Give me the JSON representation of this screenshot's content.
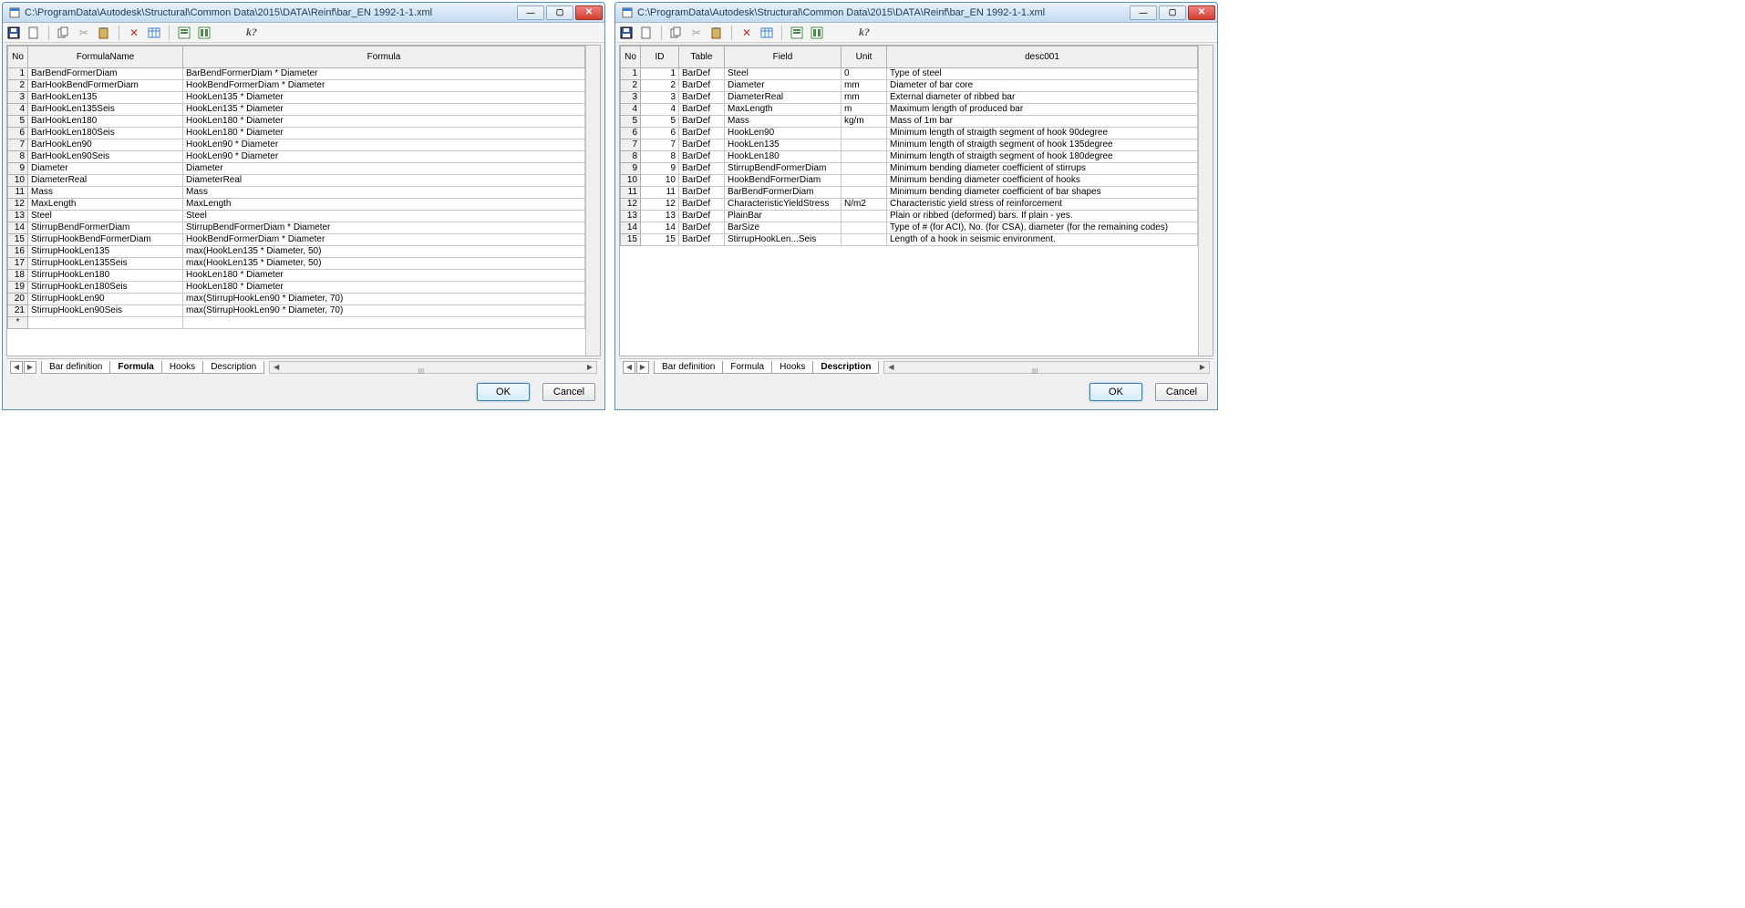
{
  "window1": {
    "title": "C:\\ProgramData\\Autodesk\\Structural\\Common Data\\2015\\DATA\\Reinf\\bar_EN 1992-1-1.xml",
    "headers": {
      "no": "No",
      "formulaName": "FormulaName",
      "formula": "Formula"
    },
    "rows": [
      {
        "no": "1",
        "name": "BarBendFormerDiam",
        "formula": "BarBendFormerDiam * Diameter"
      },
      {
        "no": "2",
        "name": "BarHookBendFormerDiam",
        "formula": "HookBendFormerDiam * Diameter"
      },
      {
        "no": "3",
        "name": "BarHookLen135",
        "formula": "HookLen135 * Diameter"
      },
      {
        "no": "4",
        "name": "BarHookLen135Seis",
        "formula": "HookLen135 * Diameter"
      },
      {
        "no": "5",
        "name": "BarHookLen180",
        "formula": "HookLen180 * Diameter"
      },
      {
        "no": "6",
        "name": "BarHookLen180Seis",
        "formula": "HookLen180 * Diameter"
      },
      {
        "no": "7",
        "name": "BarHookLen90",
        "formula": "HookLen90 * Diameter"
      },
      {
        "no": "8",
        "name": "BarHookLen90Seis",
        "formula": "HookLen90 * Diameter"
      },
      {
        "no": "9",
        "name": "Diameter",
        "formula": "Diameter"
      },
      {
        "no": "10",
        "name": "DiameterReal",
        "formula": "DiameterReal"
      },
      {
        "no": "11",
        "name": "Mass",
        "formula": "Mass"
      },
      {
        "no": "12",
        "name": "MaxLength",
        "formula": "MaxLength"
      },
      {
        "no": "13",
        "name": "Steel",
        "formula": "Steel"
      },
      {
        "no": "14",
        "name": "StirrupBendFormerDiam",
        "formula": "StirrupBendFormerDiam * Diameter"
      },
      {
        "no": "15",
        "name": "StirrupHookBendFormerDiam",
        "formula": "HookBendFormerDiam * Diameter"
      },
      {
        "no": "16",
        "name": "StirrupHookLen135",
        "formula": "max(HookLen135 * Diameter, 50)"
      },
      {
        "no": "17",
        "name": "StirrupHookLen135Seis",
        "formula": "max(HookLen135 * Diameter, 50)"
      },
      {
        "no": "18",
        "name": "StirrupHookLen180",
        "formula": "HookLen180 * Diameter"
      },
      {
        "no": "19",
        "name": "StirrupHookLen180Seis",
        "formula": "HookLen180 * Diameter"
      },
      {
        "no": "20",
        "name": "StirrupHookLen90",
        "formula": "max(StirrupHookLen90 * Diameter, 70)"
      },
      {
        "no": "21",
        "name": "StirrupHookLen90Seis",
        "formula": "max(StirrupHookLen90 * Diameter, 70)"
      }
    ],
    "emptyRow": "*",
    "tabs": {
      "t1": "Bar definition",
      "t2": "Formula",
      "t3": "Hooks",
      "t4": "Description"
    },
    "activeTab": "t2",
    "ok": "OK",
    "cancel": "Cancel",
    "scrollGrip": "III"
  },
  "window2": {
    "title": "C:\\ProgramData\\Autodesk\\Structural\\Common Data\\2015\\DATA\\Reinf\\bar_EN 1992-1-1.xml",
    "headers": {
      "no": "No",
      "id": "ID",
      "table": "Table",
      "field": "Field",
      "unit": "Unit",
      "desc": "desc001"
    },
    "rows": [
      {
        "no": "1",
        "id": "1",
        "table": "BarDef",
        "field": "Steel",
        "unit": "0",
        "desc": "Type of steel"
      },
      {
        "no": "2",
        "id": "2",
        "table": "BarDef",
        "field": "Diameter",
        "unit": "mm",
        "desc": "Diameter of bar core"
      },
      {
        "no": "3",
        "id": "3",
        "table": "BarDef",
        "field": "DiameterReal",
        "unit": "mm",
        "desc": "External diameter of ribbed bar"
      },
      {
        "no": "4",
        "id": "4",
        "table": "BarDef",
        "field": "MaxLength",
        "unit": "m",
        "desc": "Maximum length of produced bar"
      },
      {
        "no": "5",
        "id": "5",
        "table": "BarDef",
        "field": "Mass",
        "unit": "kg/m",
        "desc": "Mass of 1m bar"
      },
      {
        "no": "6",
        "id": "6",
        "table": "BarDef",
        "field": "HookLen90",
        "unit": "",
        "desc": "Minimum length of straigth segment of hook 90degree"
      },
      {
        "no": "7",
        "id": "7",
        "table": "BarDef",
        "field": "HookLen135",
        "unit": "",
        "desc": "Minimum length of straigth segment of hook 135degree"
      },
      {
        "no": "8",
        "id": "8",
        "table": "BarDef",
        "field": "HookLen180",
        "unit": "",
        "desc": "Minimum length of straigth segment of hook 180degree"
      },
      {
        "no": "9",
        "id": "9",
        "table": "BarDef",
        "field": "StirrupBendFormerDiam",
        "unit": "",
        "desc": "Minimum bending diameter coefficient of stirrups"
      },
      {
        "no": "10",
        "id": "10",
        "table": "BarDef",
        "field": "HookBendFormerDiam",
        "unit": "",
        "desc": "Minimum bending diameter coefficient of hooks"
      },
      {
        "no": "11",
        "id": "11",
        "table": "BarDef",
        "field": "BarBendFormerDiam",
        "unit": "",
        "desc": "Minimum bending diameter coefficient of bar shapes"
      },
      {
        "no": "12",
        "id": "12",
        "table": "BarDef",
        "field": "CharacteristicYieldStress",
        "unit": "N/m2",
        "desc": "Characteristic yield stress of reinforcement"
      },
      {
        "no": "13",
        "id": "13",
        "table": "BarDef",
        "field": "PlainBar",
        "unit": "",
        "desc": "Plain or ribbed (deformed) bars. If plain - yes."
      },
      {
        "no": "14",
        "id": "14",
        "table": "BarDef",
        "field": "BarSize",
        "unit": "",
        "desc": "Type of # (for ACI), No. (for CSA), diameter (for  the remaining codes)"
      },
      {
        "no": "15",
        "id": "15",
        "table": "BarDef",
        "field": "StirrupHookLen...Seis",
        "unit": "",
        "desc": "Length of  a hook in seismic environment."
      }
    ],
    "tabs": {
      "t1": "Bar definition",
      "t2": "Formula",
      "t3": "Hooks",
      "t4": "Description"
    },
    "activeTab": "t4",
    "ok": "OK",
    "cancel": "Cancel",
    "scrollGrip": "III"
  },
  "toolbar": {
    "save": "save",
    "new": "new",
    "copy": "copy",
    "cut": "cut",
    "paste": "paste",
    "delete": "delete",
    "separator": "sep",
    "calendar": "calendar",
    "pv1": "preview1",
    "pv2": "preview2",
    "help": "help"
  }
}
